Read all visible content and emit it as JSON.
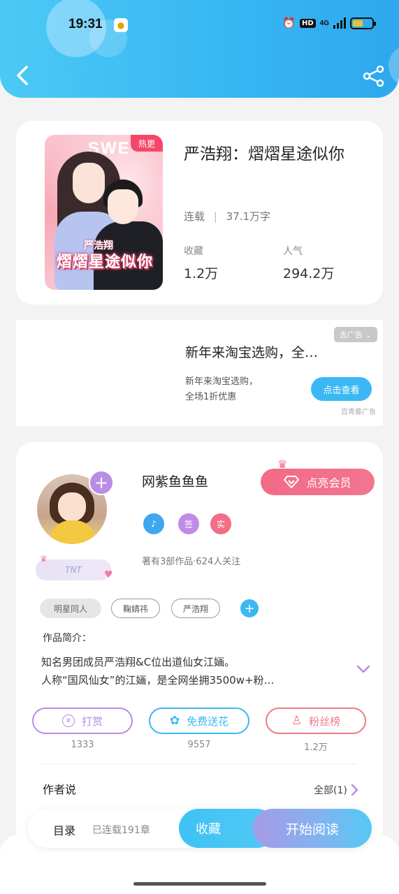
{
  "status_bar": {
    "time": "19:31",
    "app_icon": "lightbulb-icon",
    "alarm_icon": "alarm-icon",
    "hd": "HD",
    "network": "4G",
    "battery_level": 0.55
  },
  "header": {
    "back_icon": "chevron-left-icon",
    "share_icon": "share-icon",
    "accent": "#36b6f2"
  },
  "book": {
    "cover_badge": "热更",
    "cover_top_text": "SWE",
    "cover_author_text": "严浩翔",
    "cover_title_text": "熠熠星途似你",
    "title": "严浩翔：熠熠星途似你",
    "status": "连载",
    "word_count": "37.1万字",
    "collect_label": "收藏",
    "collect_value": "1.2万",
    "popularity_label": "人气",
    "popularity_value": "294.2万"
  },
  "ad": {
    "close_label": "去广告",
    "title": "新年来淘宝选购，全…",
    "description_line1": "新年来淘宝选购，",
    "description_line2": "全场1折优惠",
    "cta": "点击查看",
    "source": "百青藤广告"
  },
  "author": {
    "name": "网紫鱼鱼鱼",
    "vip_button": "点亮会员",
    "badges": [
      {
        "label": "♪",
        "color": "#3fa7f0"
      },
      {
        "label": "签",
        "color": "#c08ae8"
      },
      {
        "label": "实",
        "color": "#f26d86"
      }
    ],
    "fan_badge": "TNT",
    "stats": "著有3部作品·624人关注",
    "tags": [
      "明星同人",
      "鞠婧祎",
      "严浩翔"
    ],
    "intro_label": "作品简介：",
    "intro_line1": "知名男团成员严浩翔&C位出道仙女江婳。",
    "intro_line2": "人称“国风仙女”的江婳，是全网坐拥3500w+粉…",
    "actions": [
      {
        "label": "打赏",
        "count": "1333",
        "color": "#b98ce6"
      },
      {
        "label": "免费送花",
        "count": "9557",
        "color": "#3bb8f3"
      },
      {
        "label": "粉丝榜",
        "count": "1.2万",
        "color": "#f07a86"
      }
    ],
    "author_says": "作者说",
    "all_link": "全部(1)"
  },
  "bottom_bar": {
    "toc": "目录",
    "status": "已连载191章",
    "collect": "收藏",
    "read": "开始阅读"
  }
}
